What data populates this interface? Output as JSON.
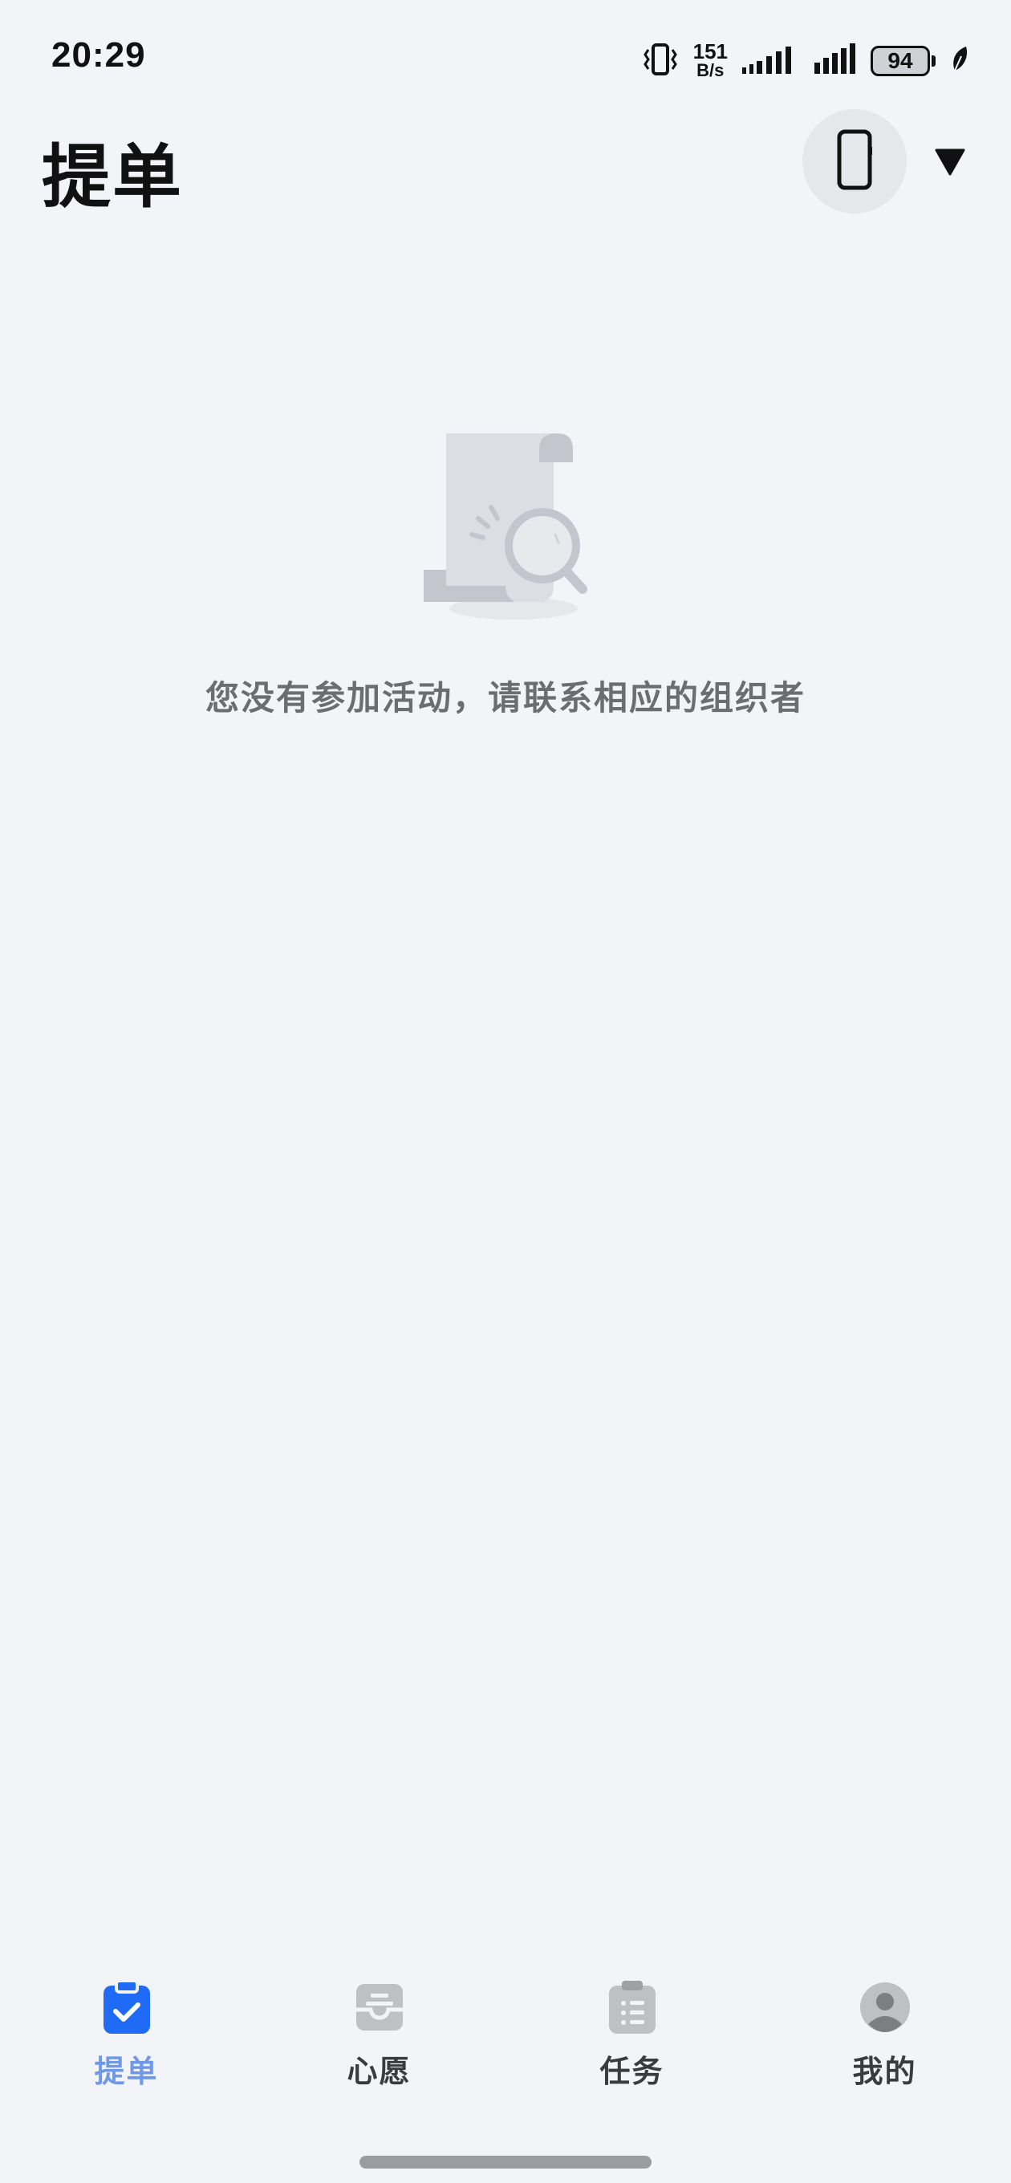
{
  "status_bar": {
    "time": "20:29",
    "net_speed_value": "151",
    "net_speed_unit": "B/s",
    "battery_level": "94"
  },
  "header": {
    "title": "提单"
  },
  "empty_state": {
    "message": "您没有参加活动，请联系相应的组织者"
  },
  "bottom_nav": {
    "items": [
      {
        "label": "提单",
        "icon": "clipboard-check-icon",
        "active": true
      },
      {
        "label": "心愿",
        "icon": "inbox-tray-icon",
        "active": false
      },
      {
        "label": "任务",
        "icon": "task-list-icon",
        "active": false
      },
      {
        "label": "我的",
        "icon": "user-avatar-icon",
        "active": false
      }
    ]
  },
  "colors": {
    "background": "#f3f4f7",
    "accent": "#1f6bf5",
    "active_label": "#6f98e6",
    "inactive_icon": "#bfc0c3",
    "text_primary": "#111111",
    "text_secondary": "#6b6d71"
  }
}
